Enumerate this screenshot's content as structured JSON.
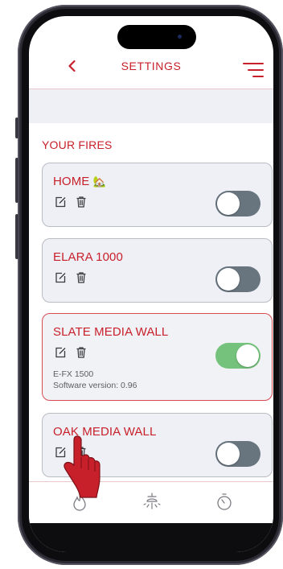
{
  "header": {
    "title": "SETTINGS"
  },
  "section_title": "YOUR FIRES",
  "fires": [
    {
      "name": "HOME",
      "emoji": "🏡",
      "toggle_on": false
    },
    {
      "name": "ELARA 1000",
      "toggle_on": false
    },
    {
      "name": "SLATE MEDIA WALL",
      "toggle_on": true,
      "model": "E-FX 1500",
      "software": "Software version: 0.96"
    },
    {
      "name": "OAK MEDIA WALL",
      "toggle_on": false
    }
  ],
  "colors": {
    "accent": "#c8202b",
    "toggle_on": "#74c27b",
    "toggle_off": "#68757f",
    "card_bg": "#eef0f5"
  },
  "icons": {
    "header_left": "chevron-left-icon",
    "header_right": "menu-icon",
    "card_actions": [
      "edit-icon",
      "trash-icon"
    ],
    "tabs": [
      "flame-icon",
      "light-icon",
      "timer-icon"
    ]
  }
}
